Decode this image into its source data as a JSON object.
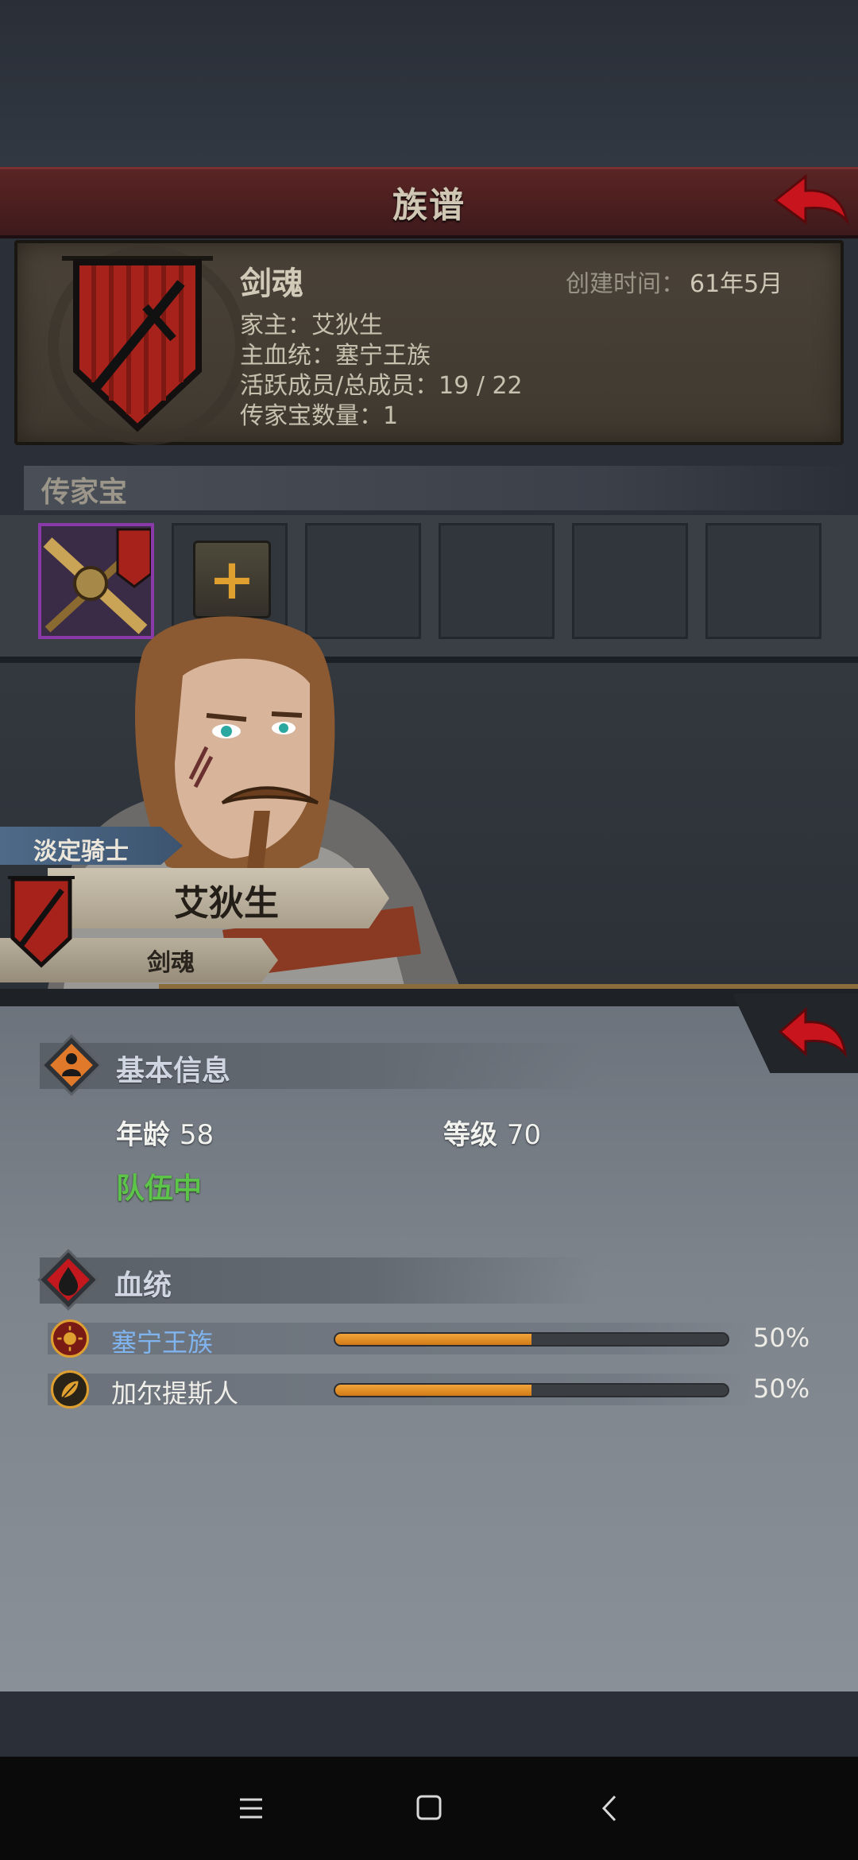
{
  "header": {
    "title": "族谱"
  },
  "family": {
    "name": "剑魂",
    "created_label": "创建时间：",
    "created_value": "61年5月",
    "lines": [
      "家主：艾狄生",
      "主血统：塞宁王族",
      "活跃成员/总成员：19 / 22",
      "传家宝数量：1"
    ]
  },
  "heirlooms": {
    "title": "传家宝",
    "add_symbol": "+",
    "slot_count": 6,
    "filled_count": 1
  },
  "character": {
    "rank": "淡定骑士",
    "name": "艾狄生",
    "family": "剑魂"
  },
  "basic_info": {
    "title": "基本信息",
    "age_label": "年龄",
    "age_value": "58",
    "level_label": "等级",
    "level_value": "70",
    "status": "队伍中"
  },
  "bloodline": {
    "title": "血统",
    "items": [
      {
        "name": "塞宁王族",
        "percent_text": "50%",
        "percent": 0.5,
        "name_color": "#7fb4ee"
      },
      {
        "name": "加尔提斯人",
        "percent_text": "50%",
        "percent": 0.5,
        "name_color": "#f0eee8"
      }
    ]
  },
  "colors": {
    "banner_red": "#5a2424",
    "crest_red": "#b3261e",
    "bar_orange": "#e89428",
    "team_green": "#5cc448",
    "rare_purple": "#8a3aa8"
  },
  "icons": {
    "back": "back-arrow-icon",
    "basic_info": "person-icon",
    "bloodline": "blood-drop-icon",
    "nav_menu": "menu-icon",
    "nav_home": "home-square-icon",
    "nav_back": "chevron-left-icon"
  }
}
